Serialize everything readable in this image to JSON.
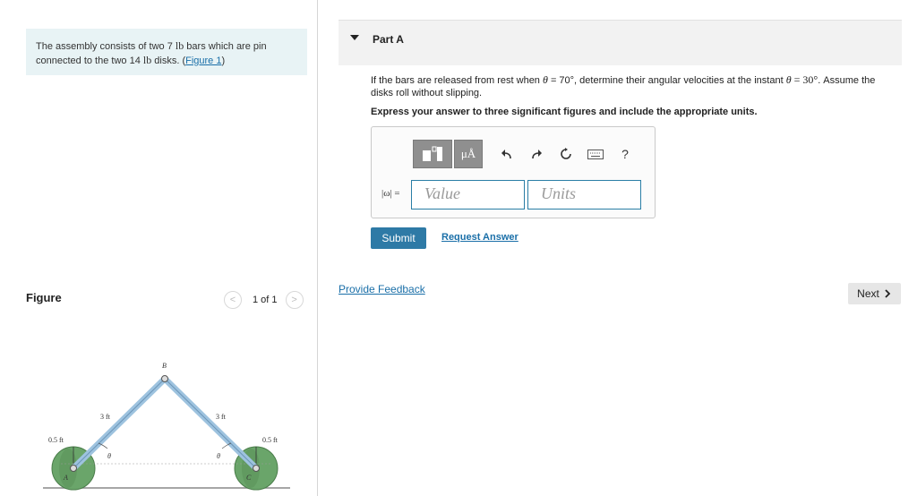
{
  "intro": {
    "text_1": "The assembly consists of two 7 ",
    "unit_1": "lb",
    "text_2": " bars which are pin connected to the two 14 ",
    "unit_2": "lb",
    "text_3": " disks. (",
    "figure_link": "Figure 1",
    "text_4": ")"
  },
  "figure_panel": {
    "title": "Figure",
    "pager_prev": "<",
    "pager_text": "1 of 1",
    "pager_next": ">"
  },
  "figure": {
    "label_b": "B",
    "label_a": "A",
    "label_c": "C",
    "bar_left_length": "3 ft",
    "bar_right_length": "3 ft",
    "radius_left": "0.5 ft",
    "radius_right": "0.5 ft",
    "theta_left": "θ",
    "theta_right": "θ"
  },
  "part": {
    "title": "Part A"
  },
  "question": {
    "q1": "If the bars are released from rest when ",
    "theta": "θ",
    "q2": " = 70°, determine their angular velocities at the instant ",
    "theta2": "θ",
    "q3": " = 30°",
    "q4": ". Assume the disks roll without slipping.",
    "instruction": "Express your answer to three significant figures and include the appropriate units."
  },
  "answer": {
    "label": "|ω| =",
    "value_placeholder": "Value",
    "units_placeholder": "Units",
    "toolbar_mu": "μÅ",
    "help": "?"
  },
  "actions": {
    "submit": "Submit",
    "request": "Request Answer",
    "feedback": "Provide Feedback",
    "next": "Next"
  },
  "colors": {
    "accent": "#2e7aa6",
    "link": "#1a6fa8",
    "intro_bg": "#e8f3f5",
    "bar": "#8fb8d8",
    "disk": "#6aa56a"
  }
}
